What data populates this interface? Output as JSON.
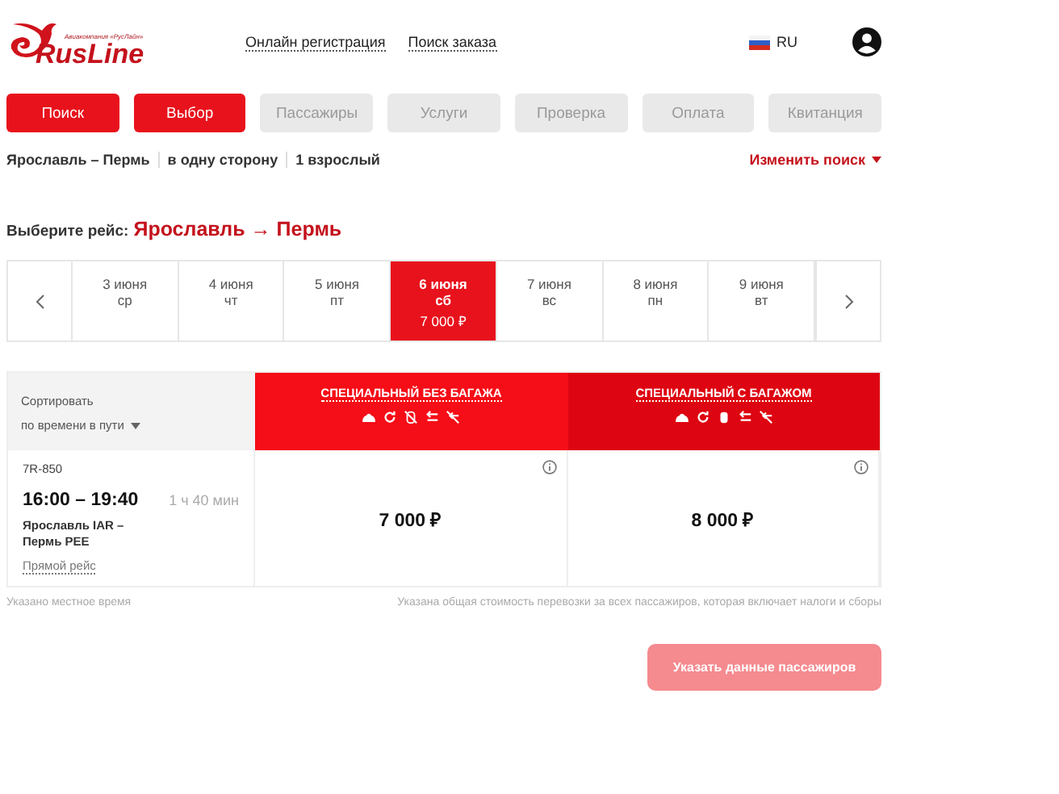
{
  "logo": {
    "tagline": "Авиакомпания «РусЛайн»",
    "name": "RusLine"
  },
  "top_links": [
    "Онлайн регистрация",
    "Поиск заказа"
  ],
  "language": "RU",
  "steps": [
    {
      "label": "Поиск",
      "completed": true
    },
    {
      "label": "Выбор",
      "completed": true
    },
    {
      "label": "Пассажиры",
      "completed": false
    },
    {
      "label": "Услуги",
      "completed": false
    },
    {
      "label": "Проверка",
      "completed": false
    },
    {
      "label": "Оплата",
      "completed": false
    },
    {
      "label": "Квитанция",
      "completed": false
    }
  ],
  "summary": [
    "Ярославль – Пермь",
    "в одну сторону",
    "1 взрослый"
  ],
  "change_search": "Изменить поиск",
  "heading": {
    "label": "Выберите рейс:",
    "from": "Ярославль",
    "arrow": "→",
    "to": "Пермь"
  },
  "dates": [
    {
      "date": "3 июня",
      "weekday": "ср",
      "selected": false
    },
    {
      "date": "4 июня",
      "weekday": "чт",
      "selected": false
    },
    {
      "date": "5 июня",
      "weekday": "пт",
      "selected": false
    },
    {
      "date": "6 июня",
      "weekday": "сб",
      "price": "7 000 ₽",
      "selected": true
    },
    {
      "date": "7 июня",
      "weekday": "вс",
      "selected": false
    },
    {
      "date": "8 июня",
      "weekday": "пн",
      "selected": false
    },
    {
      "date": "9 июня",
      "weekday": "вт",
      "selected": false
    }
  ],
  "sort": {
    "label": "Сортировать",
    "value": "по времени в пути"
  },
  "fares": [
    {
      "name": "СПЕЦИАЛЬНЫЙ БЕЗ БАГАЖА",
      "baggage_included": false,
      "color": "#f50d17"
    },
    {
      "name": "СПЕЦИАЛЬНЫЙ С БАГАЖОМ",
      "baggage_included": true,
      "color": "#dd0511"
    }
  ],
  "flight": {
    "number": "7R-850",
    "times": "16:00 – 19:40",
    "duration": "1 ч 40 мин",
    "route": "Ярославль IAR – Пермь PEE",
    "type": "Прямой рейс",
    "prices": [
      "7 000 ₽",
      "8 000 ₽"
    ]
  },
  "notes": [
    "Указано местное время",
    "Указана общая стоимость перевозки за всех пассажиров, которая включает налоги и сборы"
  ],
  "continue_button": {
    "label": "Указать данные пассажиров",
    "disabled": true
  }
}
